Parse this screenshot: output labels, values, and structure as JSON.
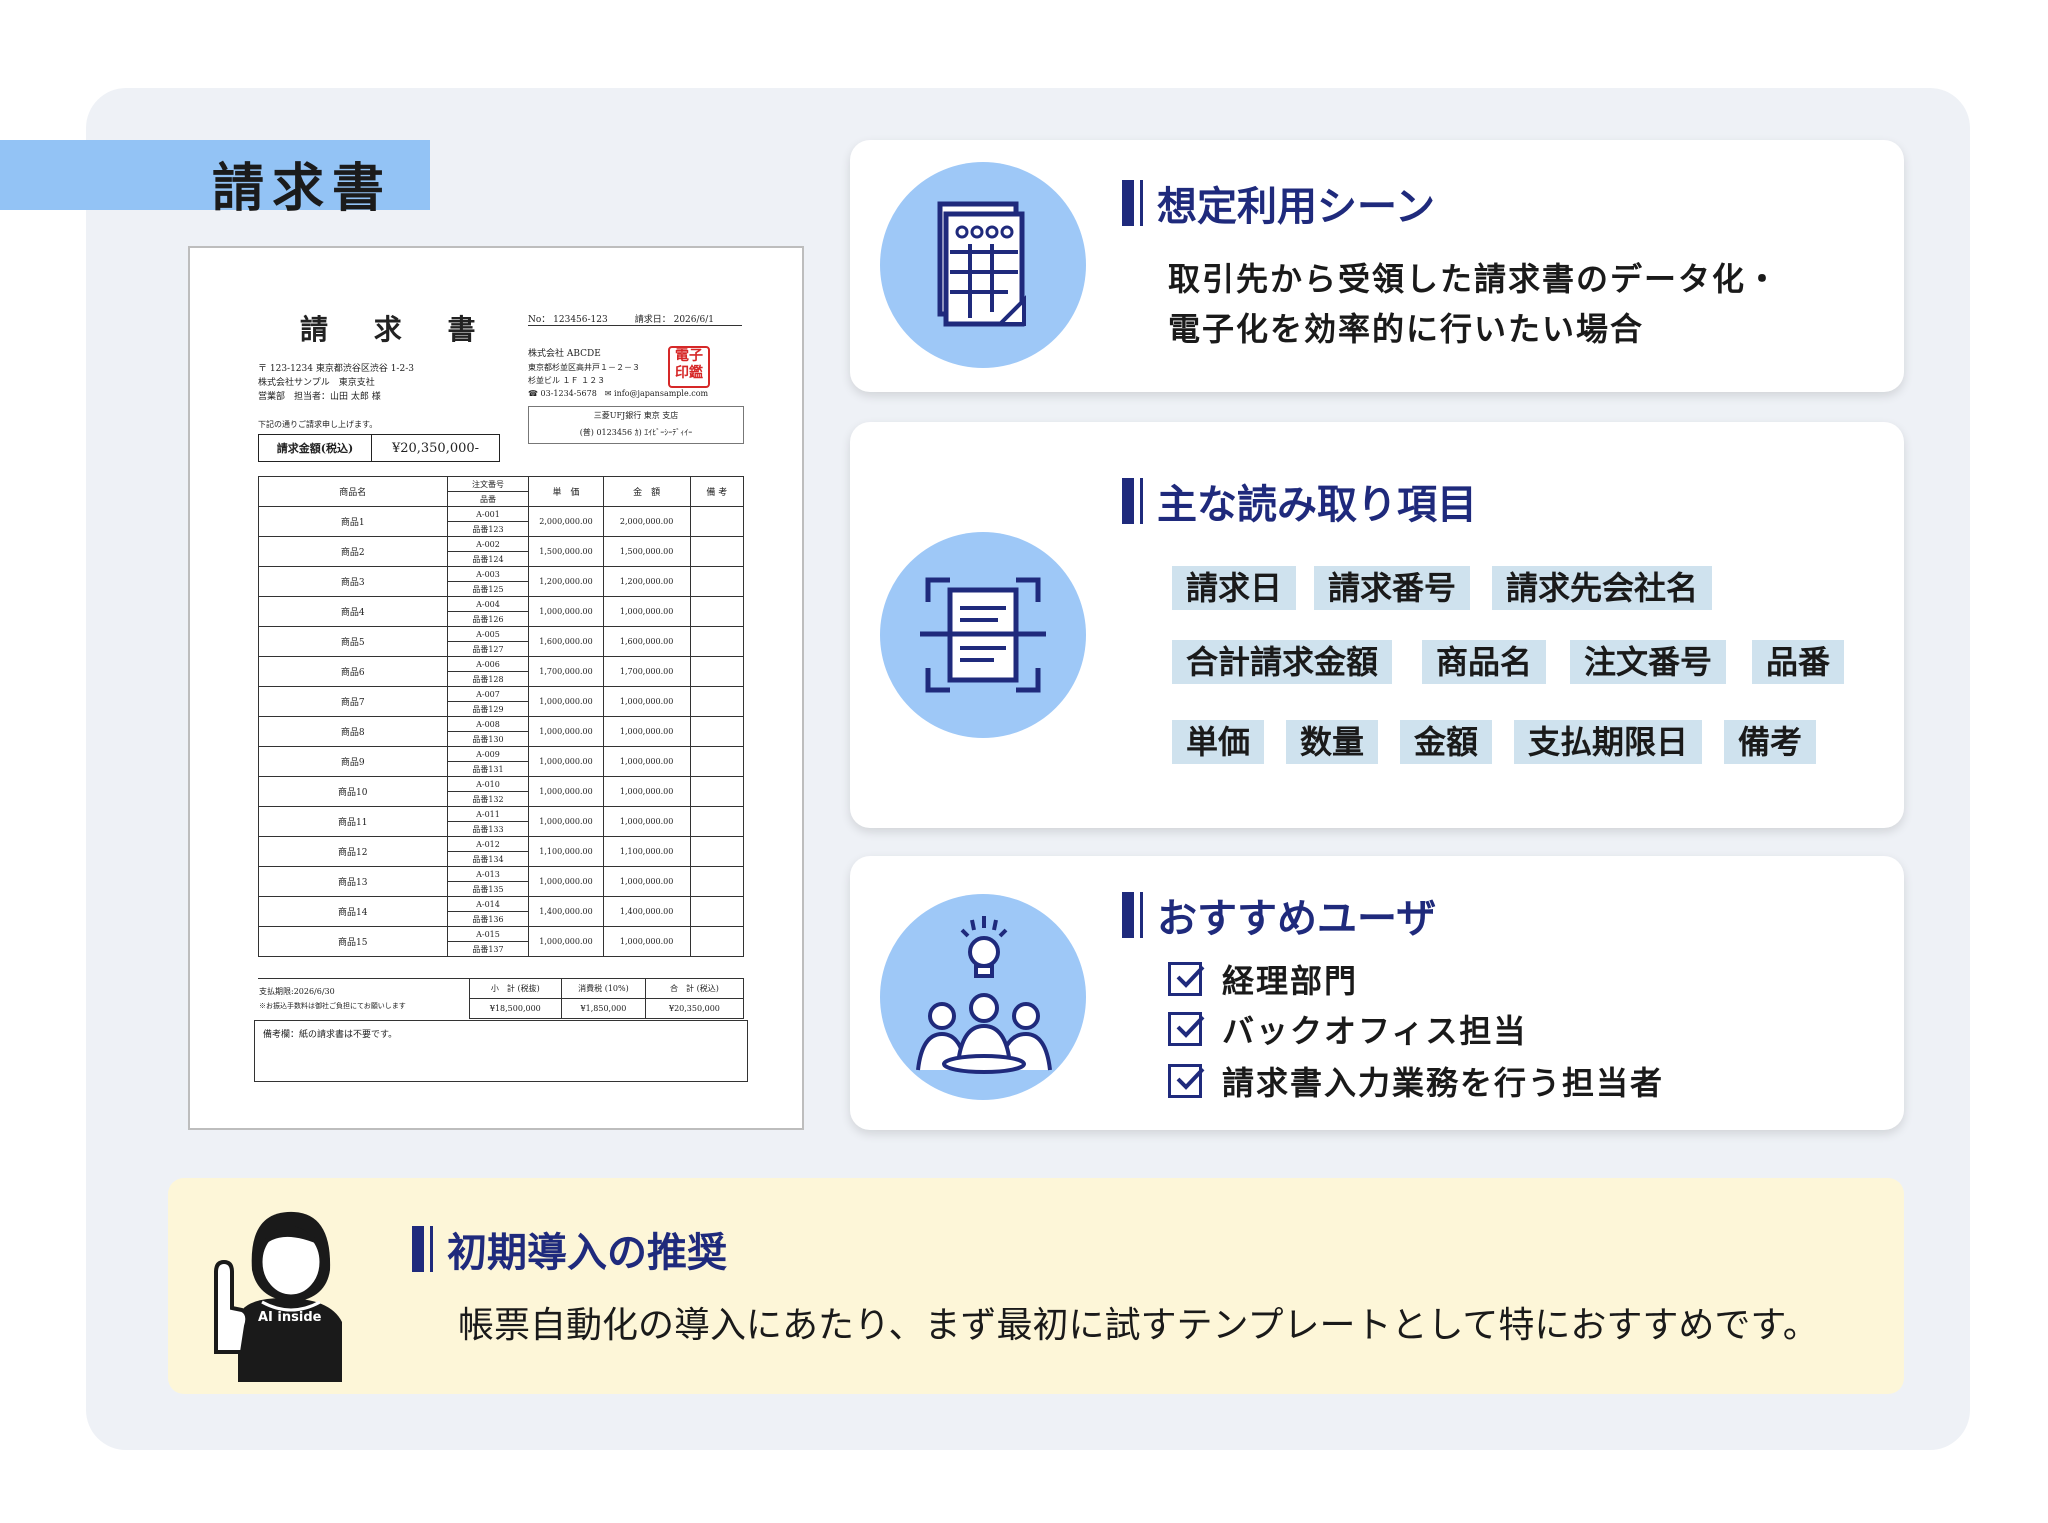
{
  "doc_type_label": "請求書",
  "invoice": {
    "title": "請 求 書",
    "meta": "No： 123456-123　　　請求日： 2026/6/1",
    "recipient": [
      "〒 123-1234 東京都渋谷区渋谷 1-2-3",
      "株式会社サンプル　東京支社",
      "営業部　担当者：山田 太郎 様"
    ],
    "issuer": [
      "株式会社 ABCDE",
      "東京都杉並区高井戸１－２－３",
      "杉並ビル １Ｆ １２３",
      "☎ 03-1234-5678　✉ info@japansample.com"
    ],
    "stamp": "電子印鑑",
    "bank": [
      "三菱UFJ銀行 東京 支店",
      "(普) 0123456 ｶ) ｴｲﾋﾞｰｼｰﾃﾞｨｲｰ"
    ],
    "intro": "下記の通りご請求申し上げます。",
    "total_label": "請求金額(税込)",
    "total_value": "¥20,350,000-",
    "headers": {
      "item": "商品名",
      "order": "注文番号",
      "code": "品番",
      "price": "単　価",
      "amount": "金　額",
      "note": "備 考"
    },
    "rows": [
      {
        "name": "商品1",
        "order": "A-001",
        "code": "品番123",
        "price": "2,000,000.00",
        "amount": "2,000,000.00"
      },
      {
        "name": "商品2",
        "order": "A-002",
        "code": "品番124",
        "price": "1,500,000.00",
        "amount": "1,500,000.00"
      },
      {
        "name": "商品3",
        "order": "A-003",
        "code": "品番125",
        "price": "1,200,000.00",
        "amount": "1,200,000.00"
      },
      {
        "name": "商品4",
        "order": "A-004",
        "code": "品番126",
        "price": "1,000,000.00",
        "amount": "1,000,000.00"
      },
      {
        "name": "商品5",
        "order": "A-005",
        "code": "品番127",
        "price": "1,600,000.00",
        "amount": "1,600,000.00"
      },
      {
        "name": "商品6",
        "order": "A-006",
        "code": "品番128",
        "price": "1,700,000.00",
        "amount": "1,700,000.00"
      },
      {
        "name": "商品7",
        "order": "A-007",
        "code": "品番129",
        "price": "1,000,000.00",
        "amount": "1,000,000.00"
      },
      {
        "name": "商品8",
        "order": "A-008",
        "code": "品番130",
        "price": "1,000,000.00",
        "amount": "1,000,000.00"
      },
      {
        "name": "商品9",
        "order": "A-009",
        "code": "品番131",
        "price": "1,000,000.00",
        "amount": "1,000,000.00"
      },
      {
        "name": "商品10",
        "order": "A-010",
        "code": "品番132",
        "price": "1,000,000.00",
        "amount": "1,000,000.00"
      },
      {
        "name": "商品11",
        "order": "A-011",
        "code": "品番133",
        "price": "1,000,000.00",
        "amount": "1,000,000.00"
      },
      {
        "name": "商品12",
        "order": "A-012",
        "code": "品番134",
        "price": "1,100,000.00",
        "amount": "1,100,000.00"
      },
      {
        "name": "商品13",
        "order": "A-013",
        "code": "品番135",
        "price": "1,000,000.00",
        "amount": "1,000,000.00"
      },
      {
        "name": "商品14",
        "order": "A-014",
        "code": "品番136",
        "price": "1,400,000.00",
        "amount": "1,400,000.00"
      },
      {
        "name": "商品15",
        "order": "A-015",
        "code": "品番137",
        "price": "1,000,000.00",
        "amount": "1,000,000.00"
      }
    ],
    "due_label": "支払期限:2026/6/30",
    "fee_note": "※お振込手数料は御社ご負担にてお願いします",
    "subtotal_label": "小　計 (税抜)",
    "tax_label": "消費税 (10%)",
    "grand_label": "合　計 (税込)",
    "subtotal_value": "¥18,500,000",
    "tax_value": "¥1,850,000",
    "grand_value": "¥20,350,000",
    "remarks": "備考欄：紙の請求書は不要です。"
  },
  "scene": {
    "heading": "想定利用シーン",
    "lines": [
      "取引先から受領した請求書のデータ化・",
      "電子化を効率的に行いたい場合"
    ]
  },
  "fields": {
    "heading": "主な読み取り項目",
    "items": [
      "請求日",
      "請求番号",
      "請求先会社名",
      "合計請求金額",
      "商品名",
      "注文番号",
      "品番",
      "単価",
      "数量",
      "金額",
      "支払期限日",
      "備考"
    ]
  },
  "users": {
    "heading": "おすすめユーザ",
    "items": [
      "経理部門",
      "バックオフィス担当",
      "請求書入力業務を行う担当者"
    ]
  },
  "recommend": {
    "heading": "初期導入の推奨",
    "text": "帳票自動化の導入にあたり、まず最初に試すテンプレートとして特におすすめです。",
    "brand": "AI inside"
  },
  "colors": {
    "accent": "#1f2a7c",
    "circle": "#9ec8f7",
    "chip": "#cfe2ee",
    "panel": "#eef1f6",
    "rec_bg": "#fdf6d8"
  }
}
